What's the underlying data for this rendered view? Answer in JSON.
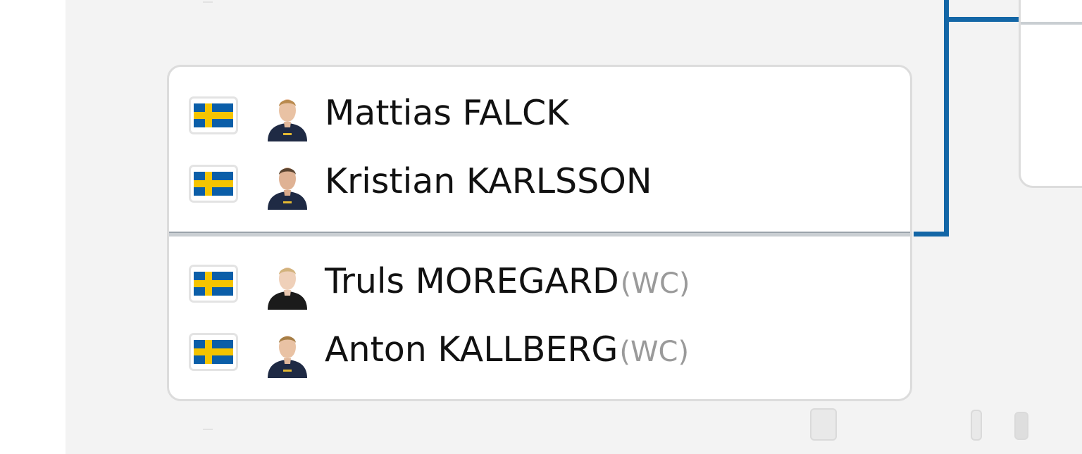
{
  "match": {
    "teams": [
      {
        "players": [
          {
            "name": "Mattias FALCK",
            "tag": "",
            "country": "Sweden",
            "flag_icon": "sweden-flag-icon"
          },
          {
            "name": "Kristian KARLSSON",
            "tag": "",
            "country": "Sweden",
            "flag_icon": "sweden-flag-icon"
          }
        ]
      },
      {
        "players": [
          {
            "name": "Truls MOREGARD",
            "tag": "(WC)",
            "country": "Sweden",
            "flag_icon": "sweden-flag-icon"
          },
          {
            "name": "Anton KALLBERG",
            "tag": "(WC)",
            "country": "Sweden",
            "flag_icon": "sweden-flag-icon"
          }
        ]
      }
    ]
  },
  "colors": {
    "bracket_line": "#1366a6",
    "flag_blue": "#0b5ea8",
    "flag_yellow": "#f5c400",
    "card_border": "#dcdcdc",
    "background": "#f3f3f3"
  }
}
